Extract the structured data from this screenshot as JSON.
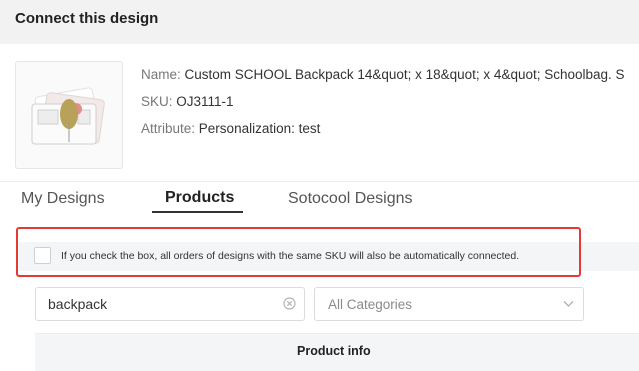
{
  "dialog": {
    "title": "Connect this design"
  },
  "product": {
    "image_alt_icon": "product-thumbnail",
    "name_label": "Name:",
    "name_value": "Custom SCHOOL Backpack 14&quot; x 18&quot; x 4&quot; Schoolbag. S",
    "sku_label": "SKU:",
    "sku_value": "OJ3111-1",
    "attribute_label": "Attribute:",
    "attribute_value": "Personalization: test"
  },
  "tabs": [
    {
      "label": "My Designs",
      "active": false
    },
    {
      "label": "Products",
      "active": true
    },
    {
      "label": "Sotocool Designs",
      "active": false
    }
  ],
  "notice": {
    "checked": false,
    "text": "If you check the box, all orders of designs with the same SKU will also be automatically connected."
  },
  "search": {
    "value": "backpack",
    "clear_icon": "clear-circle-icon"
  },
  "category_select": {
    "selected": "All Categories",
    "icon": "chevron-down-icon"
  },
  "table": {
    "columns": [
      "Product info"
    ]
  },
  "colors": {
    "highlight_border": "#e53935",
    "header_bg": "#f2f2f2",
    "notice_bg": "#f4f5f7"
  }
}
